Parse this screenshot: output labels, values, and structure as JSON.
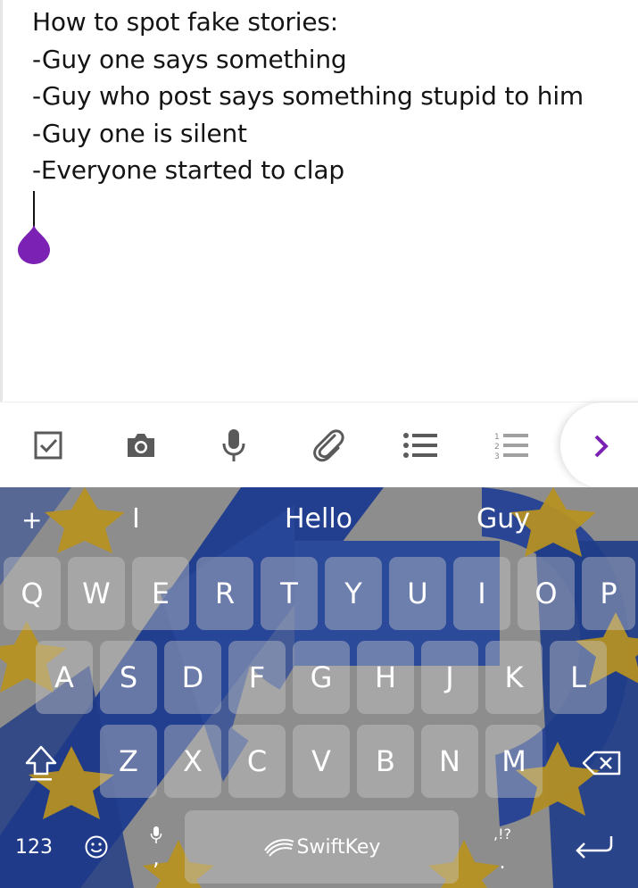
{
  "note": {
    "lines": [
      "How to spot fake stories:",
      "-Guy one says something",
      "-Guy who post says something stupid to him",
      "-Guy one is silent",
      "-Everyone started to clap"
    ],
    "caret_handle_color": "#7b22b4"
  },
  "toolbar": {
    "icons": [
      "checkbox-icon",
      "camera-icon",
      "microphone-icon",
      "paperclip-icon",
      "bullet-list-icon",
      "numbered-list-icon",
      "chevron-right-icon"
    ],
    "accent": "#7b22b4",
    "icon_color": "#5a5a5a",
    "numbered_digits": [
      "1",
      "2",
      "3"
    ]
  },
  "keyboard": {
    "suggestions": {
      "plus": "+",
      "left": "I",
      "center": "Hello",
      "right": "Guy"
    },
    "row1": [
      "Q",
      "W",
      "E",
      "R",
      "T",
      "Y",
      "U",
      "I",
      "O",
      "P"
    ],
    "row2": [
      "A",
      "S",
      "D",
      "F",
      "G",
      "H",
      "J",
      "K",
      "L"
    ],
    "row3": [
      "Z",
      "X",
      "C",
      "V",
      "B",
      "N",
      "M"
    ],
    "numbers_key": "123",
    "space_brand": "SwiftKey",
    "punct_key": ",!?",
    "period": ".",
    "comma": ",",
    "theme": {
      "blue": "#2b4a9a",
      "gold": "#b8931f",
      "gray": "#8d8d8d"
    }
  }
}
